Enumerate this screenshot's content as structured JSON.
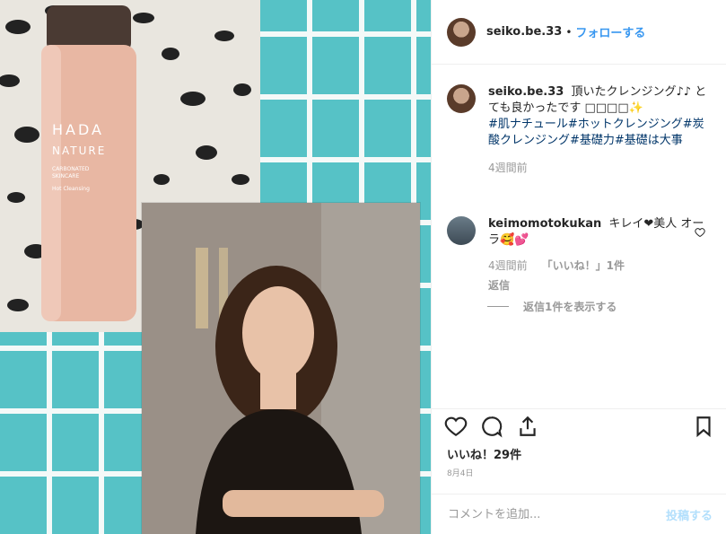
{
  "header": {
    "username": "seiko.be.33",
    "follow": "フォローする"
  },
  "product": {
    "brand_line1": "HADA",
    "brand_line2": "NATURE",
    "text1": "CARBONATED",
    "text2": "SKINCARE",
    "text3": "Hot Cleansing"
  },
  "caption": {
    "username": "seiko.be.33",
    "text": "頂いたクレンジング♪♪ とても良かったです □□□□✨",
    "tags": "#肌ナチュール#ホットクレンジング#炭酸クレンジング#基礎力#基礎は大事",
    "time": "4週間前"
  },
  "comment": {
    "username": "keimomotokukan",
    "text": "キレイ❤美人 オーラ🥰💕",
    "time": "4週間前",
    "like_count": "「いいね！」1件",
    "reply": "返信"
  },
  "replies": {
    "label": "返信1件を表示する"
  },
  "footer": {
    "likes": "いいね！29件",
    "date": "8月4日",
    "comment_placeholder": "コメントを追加...",
    "post": "投稿する"
  },
  "colors": {
    "accent": "#3897f0",
    "teal": "#56c2c6",
    "bottle": "#e8b7a3"
  }
}
